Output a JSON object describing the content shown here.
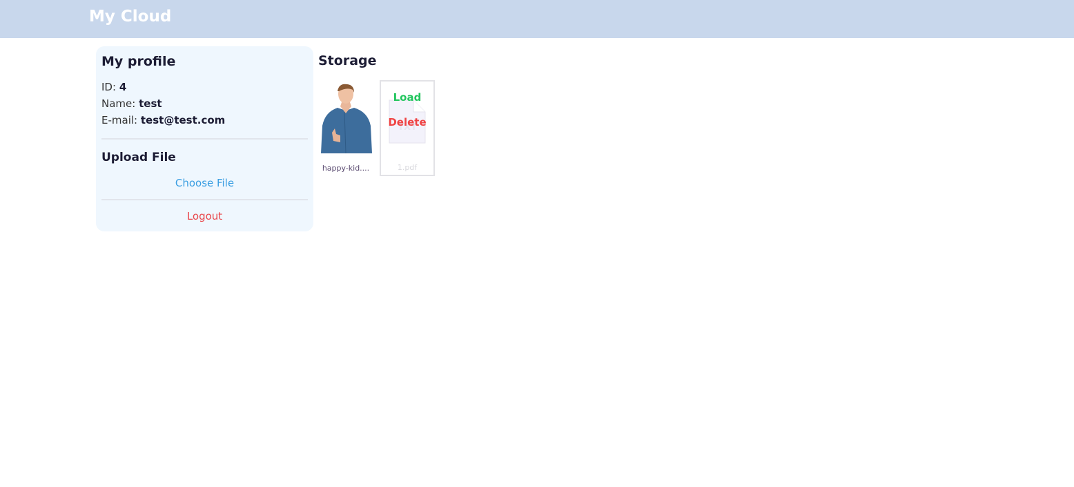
{
  "header": {
    "title": "My Cloud"
  },
  "profile": {
    "title": "My profile",
    "id_label": "ID:",
    "id_value": "4",
    "name_label": "Name:",
    "name_value": "test",
    "email_label": "E-mail:",
    "email_value": "test@test.com",
    "upload_title": "Upload File",
    "choose_file": "Choose File",
    "logout": "Logout"
  },
  "storage": {
    "title": "Storage",
    "files": [
      {
        "name": "happy-kid....",
        "type": "image"
      },
      {
        "name": "1.pdf",
        "type": "file",
        "icon_text": "TXT",
        "load_label": "Load",
        "delete_label": "Delete"
      }
    ]
  },
  "colors": {
    "header": "#c8d7ec",
    "card": "#eff7fe",
    "link": "#3a9ee2",
    "danger": "#ef4444",
    "success": "#22c55e"
  }
}
